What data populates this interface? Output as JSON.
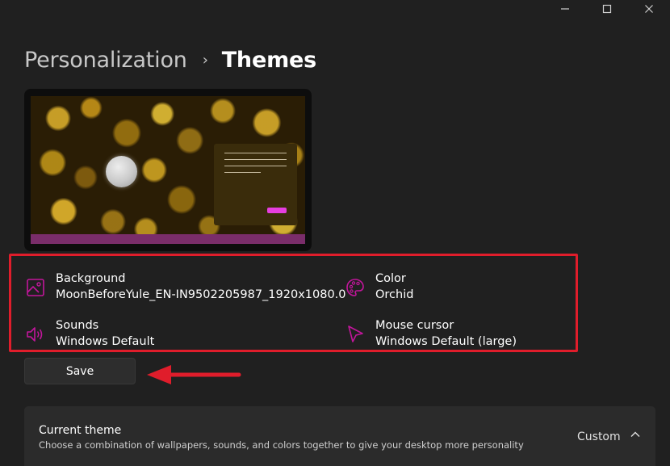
{
  "window": {
    "minimize_glyph": "—",
    "maximize_glyph": "☐",
    "close_glyph": "✕"
  },
  "breadcrumb": {
    "parent": "Personalization",
    "separator": "›",
    "current": "Themes"
  },
  "theme_settings": {
    "background": {
      "label": "Background",
      "value": "MoonBeforeYule_EN-IN9502205987_1920x1080.0",
      "icon": "image-icon"
    },
    "color": {
      "label": "Color",
      "value": "Orchid",
      "icon": "palette-icon"
    },
    "sounds": {
      "label": "Sounds",
      "value": "Windows Default",
      "icon": "speaker-icon"
    },
    "mouse_cursor": {
      "label": "Mouse cursor",
      "value": "Windows Default (large)",
      "icon": "cursor-icon"
    }
  },
  "save_label": "Save",
  "current_theme": {
    "title": "Current theme",
    "description": "Choose a combination of wallpapers, sounds, and colors together to give your desktop more personality",
    "value": "Custom"
  },
  "colors": {
    "accent": "#c2169b",
    "highlight_border": "#e01d2b",
    "annotation_arrow": "#e01d2b"
  }
}
